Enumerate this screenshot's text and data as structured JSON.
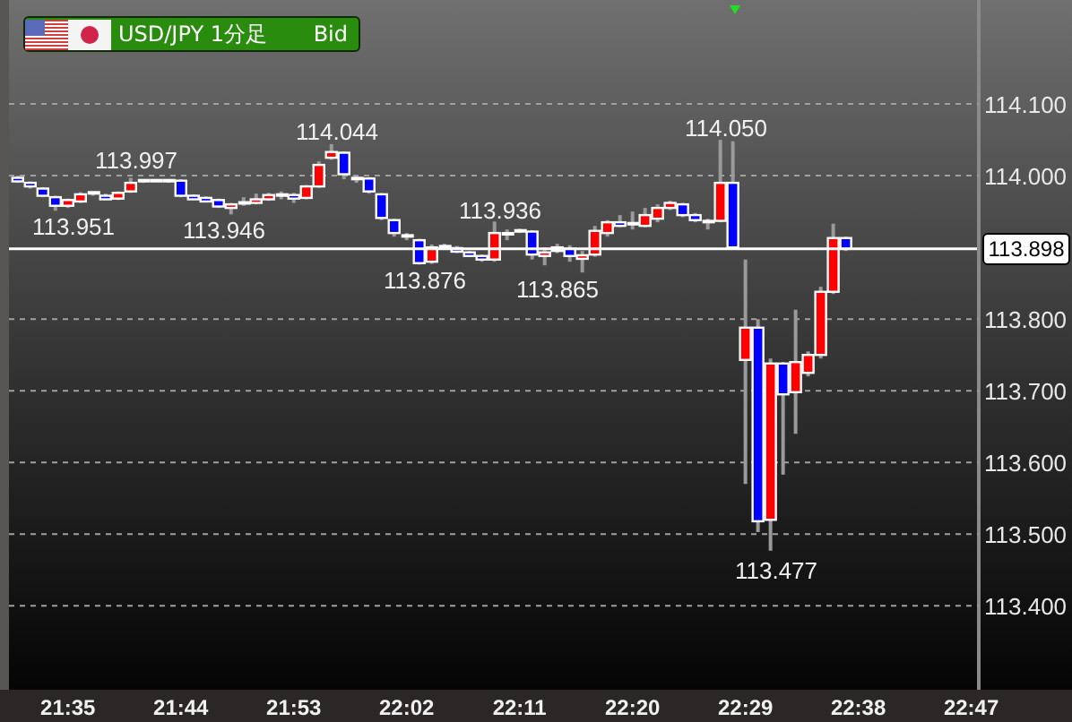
{
  "badge": {
    "symbol": "USD/JPY 1分足",
    "side": "Bid"
  },
  "chart_data": {
    "type": "candlestick",
    "grid": true,
    "ylim": [
      113.283,
      114.245
    ],
    "categories": [
      null,
      null,
      null,
      null,
      "21:35",
      null,
      null,
      null,
      null,
      null,
      null,
      null,
      null,
      "21:44",
      null,
      null,
      null,
      null,
      null,
      null,
      null,
      null,
      "21:53",
      null,
      null,
      null,
      null,
      null,
      null,
      null,
      null,
      "22:02",
      null,
      null,
      null,
      null,
      null,
      null,
      null,
      null,
      "22:11",
      null,
      null,
      null,
      null,
      null,
      null,
      null,
      null,
      "22:20",
      null,
      null,
      null,
      null,
      null,
      null,
      null,
      null,
      "22:29",
      null,
      null,
      null,
      null,
      null,
      null,
      null,
      null,
      "22:38",
      null,
      null,
      null,
      null,
      null,
      null,
      null,
      null,
      "22:47"
    ],
    "yticks": [
      {
        "value": 113.4,
        "label": "113.400"
      },
      {
        "value": 113.5,
        "label": "113.500"
      },
      {
        "value": 113.6,
        "label": "113.600"
      },
      {
        "value": 113.7,
        "label": "113.700"
      },
      {
        "value": 113.8,
        "label": "113.800"
      },
      {
        "value": 114.0,
        "label": "114.000"
      },
      {
        "value": 114.1,
        "label": "114.100"
      }
    ],
    "ohlc": [
      [
        113.997,
        114.0,
        113.99,
        113.993
      ],
      [
        113.99,
        113.992,
        113.982,
        113.985
      ],
      [
        113.982,
        113.984,
        113.97,
        113.972
      ],
      [
        113.97,
        113.972,
        113.951,
        113.958
      ],
      [
        113.958,
        113.968,
        113.955,
        113.966
      ],
      [
        113.964,
        113.977,
        113.962,
        113.974
      ],
      [
        113.975,
        113.978,
        113.972,
        113.976
      ],
      [
        113.972,
        113.975,
        113.966,
        113.968
      ],
      [
        113.968,
        113.978,
        113.966,
        113.976
      ],
      [
        113.978,
        113.997,
        113.976,
        113.99
      ],
      [
        113.992,
        113.995,
        113.99,
        113.993
      ],
      [
        113.993,
        113.995,
        113.991,
        113.993
      ],
      [
        113.993,
        113.994,
        113.99,
        113.992
      ],
      [
        113.993,
        113.995,
        113.97,
        113.972
      ],
      [
        113.972,
        113.974,
        113.967,
        113.969
      ],
      [
        113.969,
        113.971,
        113.965,
        113.967
      ],
      [
        113.966,
        113.968,
        113.955,
        113.957
      ],
      [
        113.955,
        113.962,
        113.946,
        113.96
      ],
      [
        113.961,
        113.97,
        113.958,
        113.962
      ],
      [
        113.962,
        113.975,
        113.96,
        113.967
      ],
      [
        113.967,
        113.976,
        113.965,
        113.973
      ],
      [
        113.972,
        113.978,
        113.967,
        113.973
      ],
      [
        113.973,
        113.976,
        113.962,
        113.968
      ],
      [
        113.969,
        113.987,
        113.967,
        113.985
      ],
      [
        113.985,
        114.02,
        113.983,
        114.015
      ],
      [
        114.025,
        114.044,
        114.022,
        114.033
      ],
      [
        114.032,
        114.034,
        113.995,
        114.002
      ],
      [
        113.995,
        114.0,
        113.99,
        113.996
      ],
      [
        113.996,
        113.998,
        113.975,
        113.978
      ],
      [
        113.974,
        113.976,
        113.938,
        113.941
      ],
      [
        113.938,
        113.94,
        113.915,
        113.92
      ],
      [
        113.915,
        113.92,
        113.91,
        113.916
      ],
      [
        113.91,
        113.912,
        113.876,
        113.878
      ],
      [
        113.88,
        113.904,
        113.877,
        113.9
      ],
      [
        113.9,
        113.905,
        113.897,
        113.901
      ],
      [
        113.899,
        113.902,
        113.892,
        113.894
      ],
      [
        113.893,
        113.895,
        113.887,
        113.89
      ],
      [
        113.888,
        113.89,
        113.88,
        113.883
      ],
      [
        113.883,
        113.936,
        113.88,
        113.92
      ],
      [
        113.918,
        113.925,
        113.91,
        113.919
      ],
      [
        113.922,
        113.926,
        113.92,
        113.923
      ],
      [
        113.922,
        113.924,
        113.883,
        113.89
      ],
      [
        113.888,
        113.9,
        113.875,
        113.893
      ],
      [
        113.895,
        113.905,
        113.892,
        113.9
      ],
      [
        113.898,
        113.903,
        113.88,
        113.888
      ],
      [
        113.886,
        113.895,
        113.865,
        113.889
      ],
      [
        113.89,
        113.93,
        113.887,
        113.923
      ],
      [
        113.92,
        113.938,
        113.915,
        113.935
      ],
      [
        113.935,
        113.945,
        113.928,
        113.93
      ],
      [
        113.932,
        113.95,
        113.925,
        113.933
      ],
      [
        113.93,
        113.955,
        113.928,
        113.945
      ],
      [
        113.94,
        113.96,
        113.935,
        113.955
      ],
      [
        113.955,
        113.965,
        113.952,
        113.962
      ],
      [
        113.96,
        113.962,
        113.942,
        113.945
      ],
      [
        113.945,
        113.948,
        113.935,
        113.938
      ],
      [
        113.935,
        113.94,
        113.925,
        113.936
      ],
      [
        113.937,
        114.05,
        113.935,
        113.99
      ],
      [
        113.99,
        114.048,
        113.898,
        113.9
      ],
      [
        113.743,
        113.883,
        113.57,
        113.788
      ],
      [
        113.788,
        113.8,
        113.503,
        113.518
      ],
      [
        113.52,
        113.745,
        113.477,
        113.738
      ],
      [
        113.738,
        113.74,
        113.583,
        113.695
      ],
      [
        113.698,
        113.813,
        113.64,
        113.74
      ],
      [
        113.725,
        113.755,
        113.72,
        113.75
      ],
      [
        113.75,
        113.845,
        113.745,
        113.838
      ],
      [
        113.838,
        113.933,
        113.835,
        113.913
      ],
      [
        113.913,
        113.915,
        113.895,
        113.898
      ],
      null,
      null,
      null,
      null,
      null,
      null,
      null,
      null,
      null,
      null
    ],
    "annotations": [
      "113.997",
      "113.951",
      "114.044",
      "113.946",
      "113.876",
      "113.936",
      "113.865",
      "114.050",
      "113.477"
    ],
    "ref_lines": [
      {
        "axis": "y",
        "value": 113.898,
        "label": "113.898"
      }
    ]
  }
}
